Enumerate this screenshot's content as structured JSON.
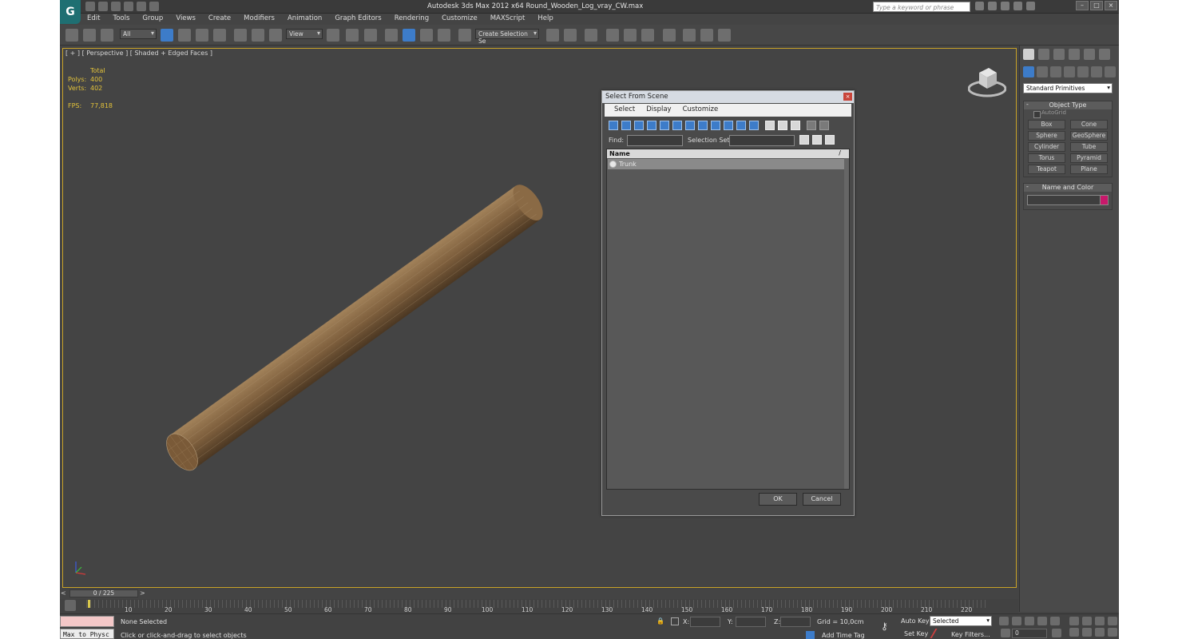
{
  "titlebar": {
    "title": "Autodesk 3ds Max  2012 x64     Round_Wooden_Log_vray_CW.max",
    "search_placeholder": "Type a keyword or phrase"
  },
  "menu": [
    "Edit",
    "Tools",
    "Group",
    "Views",
    "Create",
    "Modifiers",
    "Animation",
    "Graph Editors",
    "Rendering",
    "Customize",
    "MAXScript",
    "Help"
  ],
  "toolbar": {
    "filter_value": "All",
    "ref_coord_value": "View",
    "selection_set_value": "Create Selection Se"
  },
  "viewport": {
    "label": "[ + ] [ Perspective ] [ Shaded + Edged Faces ]",
    "stats": {
      "total_label": "Total",
      "polys_label": "Polys:",
      "polys_value": "400",
      "verts_label": "Verts:",
      "verts_value": "402",
      "fps_label": "FPS:",
      "fps_value": "77,818"
    }
  },
  "dialog": {
    "title": "Select From Scene",
    "menu": [
      "Select",
      "Display",
      "Customize"
    ],
    "find_label": "Find:",
    "selection_set_label": "Selection Set:",
    "column_name": "Name",
    "sort_indicator": "/",
    "items": [
      "Trunk"
    ],
    "ok_label": "OK",
    "cancel_label": "Cancel"
  },
  "command_panel": {
    "category_value": "Standard Primitives",
    "object_type_title": "Object Type",
    "autogrid_label": "AutoGrid",
    "primitives": [
      "Box",
      "Cone",
      "Sphere",
      "GeoSphere",
      "Cylinder",
      "Tube",
      "Torus",
      "Pyramid",
      "Teapot",
      "Plane"
    ],
    "name_color_title": "Name and Color",
    "object_color": "#c8186b"
  },
  "timeline": {
    "slider_label": "0 / 225",
    "ticks": [
      "10",
      "20",
      "30",
      "40",
      "50",
      "60",
      "70",
      "80",
      "90",
      "100",
      "110",
      "120",
      "130",
      "140",
      "150",
      "160",
      "170",
      "180",
      "190",
      "200",
      "210",
      "220"
    ]
  },
  "statusbar": {
    "maxscript_label": "Max to Physc",
    "selection_status": "None Selected",
    "prompt": "Click or click-and-drag to select objects",
    "x_label": "X:",
    "y_label": "Y:",
    "z_label": "Z:",
    "grid_label": "Grid = 10,0cm",
    "add_time_tag": "Add Time Tag",
    "auto_key_label": "Auto Key",
    "set_key_label": "Set Key",
    "selected_value": "Selected",
    "key_filters_label": "Key Filters...",
    "frame_value": "0"
  },
  "colors": {
    "viewport_border": "#c9a227",
    "stats_text": "#e2c23a",
    "active_blue": "#3d7cc9",
    "log_wood": "#8a6a45"
  }
}
